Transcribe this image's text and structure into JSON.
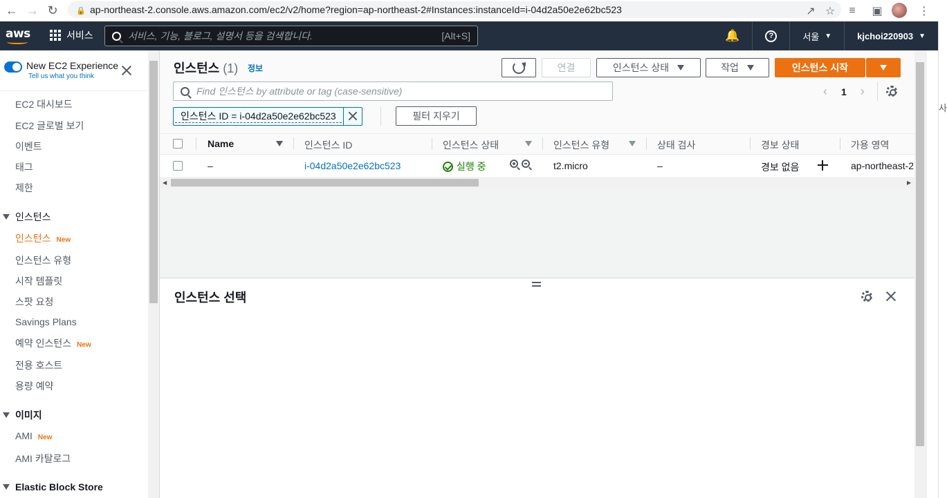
{
  "browser": {
    "url": "ap-northeast-2.console.aws.amazon.com/ec2/v2/home?region=ap-northeast-2#Instances:instanceId=i-04d2a50e2e62bc523"
  },
  "topnav": {
    "logo": "aws",
    "services": "서비스",
    "search_placeholder": "서비스, 기능, 블로그, 설명서 등을 검색합니다.",
    "search_shortcut": "[Alt+S]",
    "region": "서울",
    "account": "kjchoi220903"
  },
  "sidebar": {
    "toggle_title": "New EC2 Experience",
    "toggle_sub": "Tell us what you think",
    "items_top": [
      "EC2 대시보드",
      "EC2 글로벌 보기",
      "이벤트",
      "태그",
      "제한"
    ],
    "section_instances": "인스턴스",
    "instances_items": [
      {
        "label": "인스턴스",
        "badge": "New"
      },
      {
        "label": "인스턴스 유형",
        "badge": ""
      },
      {
        "label": "시작 템플릿",
        "badge": ""
      },
      {
        "label": "스팟 요청",
        "badge": ""
      },
      {
        "label": "Savings Plans",
        "badge": ""
      },
      {
        "label": "예약 인스턴스",
        "badge": "New"
      },
      {
        "label": "전용 호스트",
        "badge": ""
      },
      {
        "label": "용량 예약",
        "badge": ""
      }
    ],
    "section_images": "이미지",
    "images_items": [
      {
        "label": "AMI",
        "badge": "New"
      },
      {
        "label": "AMI 카탈로그",
        "badge": ""
      }
    ],
    "section_ebs": "Elastic Block Store"
  },
  "main": {
    "title": "인스턴스",
    "count": "(1)",
    "info": "정보",
    "btn_connect": "연결",
    "btn_state": "인스턴스 상태",
    "btn_actions": "작업",
    "btn_launch": "인스턴스 시작",
    "filter_placeholder": "Find 인스턴스 by attribute or tag (case-sensitive)",
    "page": "1",
    "token": "인스턴스 ID = i-04d2a50e2e62bc523",
    "clear_filters": "필터 지우기",
    "columns": [
      "Name",
      "인스턴스 ID",
      "인스턴스 상태",
      "인스턴스 유형",
      "상태 검사",
      "경보 상태",
      "가용 영역"
    ],
    "row": {
      "name": "–",
      "instance_id": "i-04d2a50e2e62bc523",
      "state": "실행 중",
      "type": "t2.micro",
      "status_check": "–",
      "alarm": "경보 없음",
      "az": "ap-northeast-2"
    }
  },
  "split_panel": {
    "title": "인스턴스 선택"
  },
  "right_fragment": "사"
}
